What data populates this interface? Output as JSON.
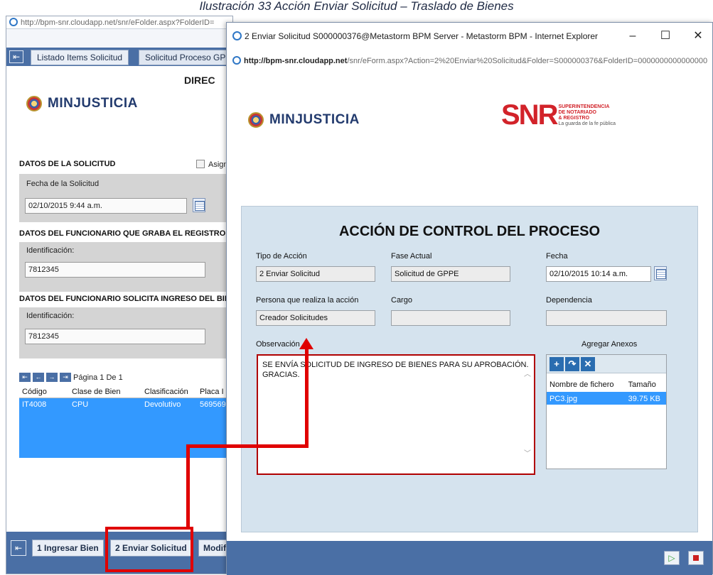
{
  "caption": "Ilustración 33 Acción Enviar Solicitud – Traslado de Bienes",
  "bg": {
    "address": "http://bpm-snr.cloudapp.net/snr/eFolder.aspx?FolderID=",
    "tabs": [
      "Listado Items Solicitud",
      "Solicitud Proceso GPPE"
    ],
    "title": "DIREC",
    "logo": "MINJUSTICIA",
    "datos_solicitud": "DATOS DE LA SOLICITUD",
    "asign": "Asign",
    "fecha_label": "Fecha de la Solicitud",
    "fecha_value": "02/10/2015 9:44 a.m.",
    "funcionario_graba": "DATOS DEL FUNCIONARIO QUE GRABA EL REGISTRO",
    "ident_label": "Identificación:",
    "ident_value": "7812345",
    "funcionario_solicita": "DATOS DEL FUNCIONARIO SOLICITA INGRESO DEL BIEN",
    "ident2_label": "Identificación:",
    "ident2_value": "7812345",
    "pager": "Página 1 De 1",
    "columns": [
      "Código",
      "Clase de Bien",
      "Clasificación",
      "Placa I"
    ],
    "row": [
      "IT4008",
      "CPU",
      "Devolutivo",
      "569569"
    ],
    "bottom_buttons": [
      "1 Ingresar Bien",
      "2 Enviar Solicitud",
      "Modif"
    ]
  },
  "popup": {
    "title": "2 Enviar Solicitud S000000376@Metastorm BPM Server - Metastorm BPM - Internet Explorer",
    "address_host": "http://bpm-snr.cloudapp.net",
    "address_path": "/snr/eForm.aspx?Action=2%20Enviar%20Solicitud&Folder=S000000376&FolderID=0000000000000000",
    "logo": "MINJUSTICIA",
    "snr_logo": "SNR",
    "snr_text": [
      "SUPERINTENDENCIA",
      "DE NOTARIADO",
      "& REGISTRO",
      "La guarda de la fe pública"
    ],
    "panel_title": "ACCIÓN DE CONTROL DEL PROCESO",
    "tipo_label": "Tipo de Acción",
    "tipo_value": "2 Enviar Solicitud",
    "fase_label": "Fase Actual",
    "fase_value": "Solicitud de GPPE",
    "fecha_label": "Fecha",
    "fecha_value": "02/10/2015 10:14 a.m.",
    "persona_label": "Persona que realiza la acción",
    "persona_value": "Creador Solicitudes",
    "cargo_label": "Cargo",
    "cargo_value": "",
    "dependencia_label": "Dependencia",
    "dependencia_value": "",
    "observacion_label": "Observación",
    "observacion_value": "SE ENVÍA SOLICITUD DE INGRESO DE BIENES PARA SU APROBACIÓN. GRACIAS.",
    "anexos_label": "Agregar Anexos",
    "anexos_columns": [
      "Nombre de fichero",
      "Tamaño"
    ],
    "anexos_row": [
      "PC3.jpg",
      "39.75 KB"
    ]
  },
  "colors": {
    "accent": "#4a6fa5",
    "selection": "#3399ff",
    "annotation": "#e00000",
    "panel": "#d5e3ee"
  }
}
